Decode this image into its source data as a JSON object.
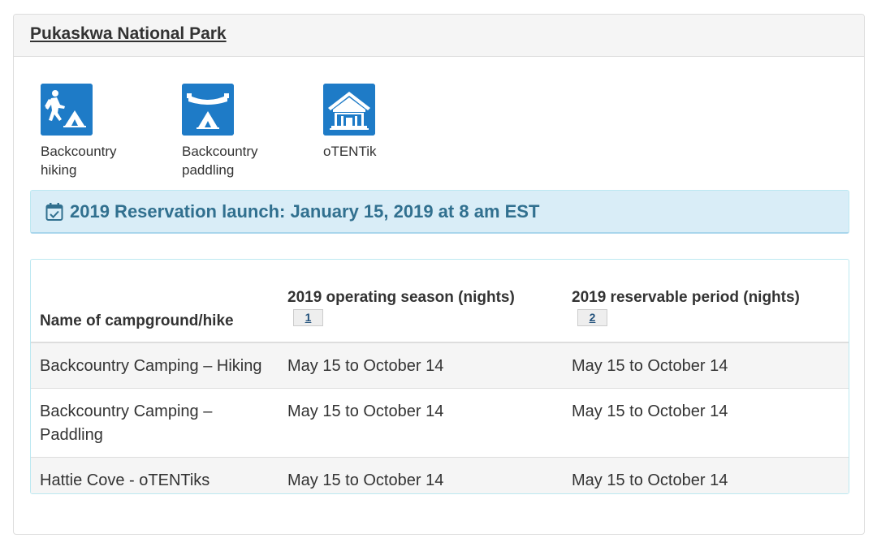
{
  "panel": {
    "title": "Pukaskwa National Park"
  },
  "activities": [
    {
      "icon": "hiker-tent-icon",
      "label": "Backcountry hiking"
    },
    {
      "icon": "canoe-tent-icon",
      "label": "Backcountry paddling"
    },
    {
      "icon": "otentik-cabin-icon",
      "label": "oTENTik"
    }
  ],
  "alert": {
    "icon": "calendar-check-icon",
    "text": "2019 Reservation launch: January 15, 2019 at 8 am EST"
  },
  "table": {
    "headers": {
      "name": "Name of campground/hike",
      "season": "2019 operating season (nights)",
      "season_footnote": "1",
      "reservable": "2019 reservable period (nights)",
      "reservable_footnote": "2"
    },
    "rows": [
      {
        "name": "Backcountry Camping – Hiking",
        "season": "May 15 to October 14",
        "reservable": "May 15 to October 14"
      },
      {
        "name": "Backcountry Camping – Paddling",
        "season": "May 15 to October 14",
        "reservable": "May 15 to October 14"
      },
      {
        "name": "Hattie Cove - oTENTiks",
        "season": "May 15 to October 14",
        "reservable": "May 15 to October 14"
      }
    ]
  },
  "colors": {
    "icon_tile": "#1e7bc7",
    "alert_bg": "#d9edf7",
    "alert_text": "#31708f"
  }
}
